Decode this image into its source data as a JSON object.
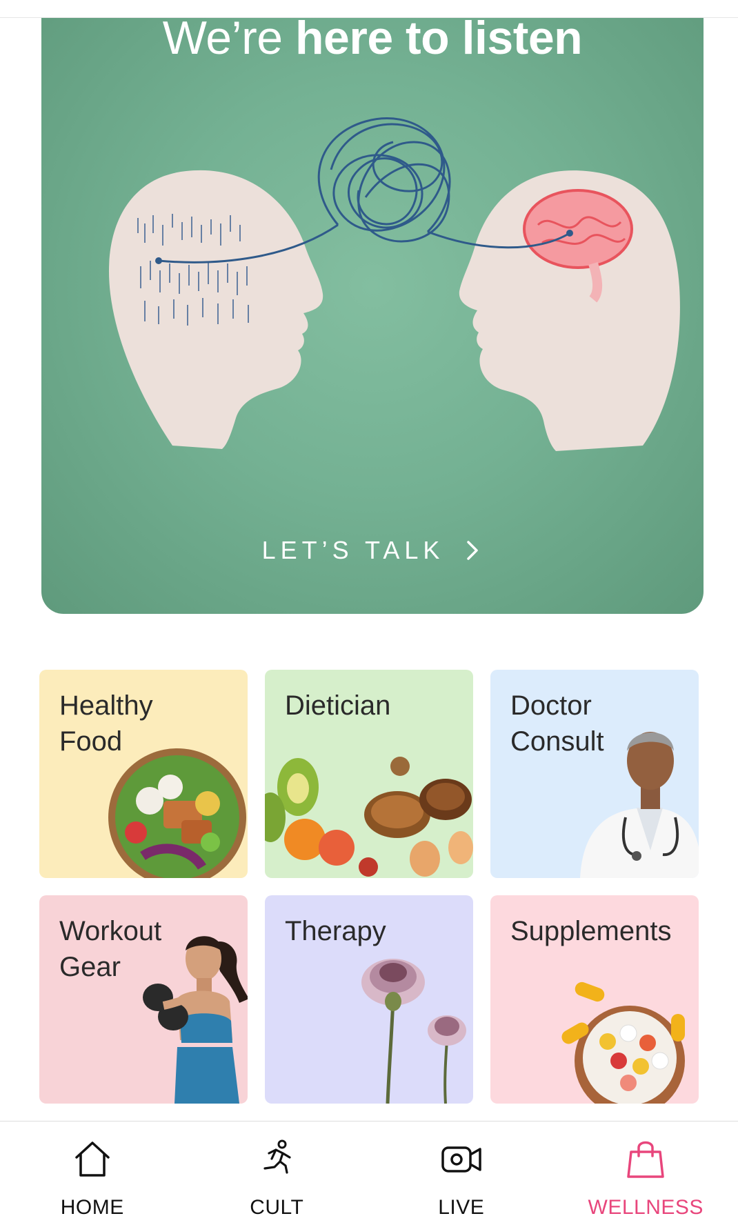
{
  "banner": {
    "title_light": "We’re ",
    "title_bold": "here to listen",
    "cta_label": "LET’S TALK",
    "colors": {
      "background": "#74b193",
      "text": "#ffffff"
    }
  },
  "categories": [
    {
      "label": "Healthy\nFood",
      "bg": "#fcecbb",
      "icon": "salad-bowl-image"
    },
    {
      "label": "Dietician",
      "bg": "#d6efcb",
      "icon": "nuts-fruits-image"
    },
    {
      "label": "Doctor\nConsult",
      "bg": "#dcecfc",
      "icon": "doctor-image"
    },
    {
      "label": "Workout\nGear",
      "bg": "#f8d3d7",
      "icon": "athlete-image"
    },
    {
      "label": "Therapy",
      "bg": "#dcdcfa",
      "icon": "flowers-image"
    },
    {
      "label": "Supplements",
      "bg": "#fdd9de",
      "icon": "pills-bowl-image"
    }
  ],
  "nav": {
    "active": "WELLNESS",
    "active_color": "#e8467c",
    "items": [
      {
        "label": "HOME",
        "icon": "home-icon"
      },
      {
        "label": "CULT",
        "icon": "running-person-icon"
      },
      {
        "label": "LIVE",
        "icon": "video-camera-icon"
      },
      {
        "label": "WELLNESS",
        "icon": "shopping-bag-icon"
      }
    ]
  }
}
